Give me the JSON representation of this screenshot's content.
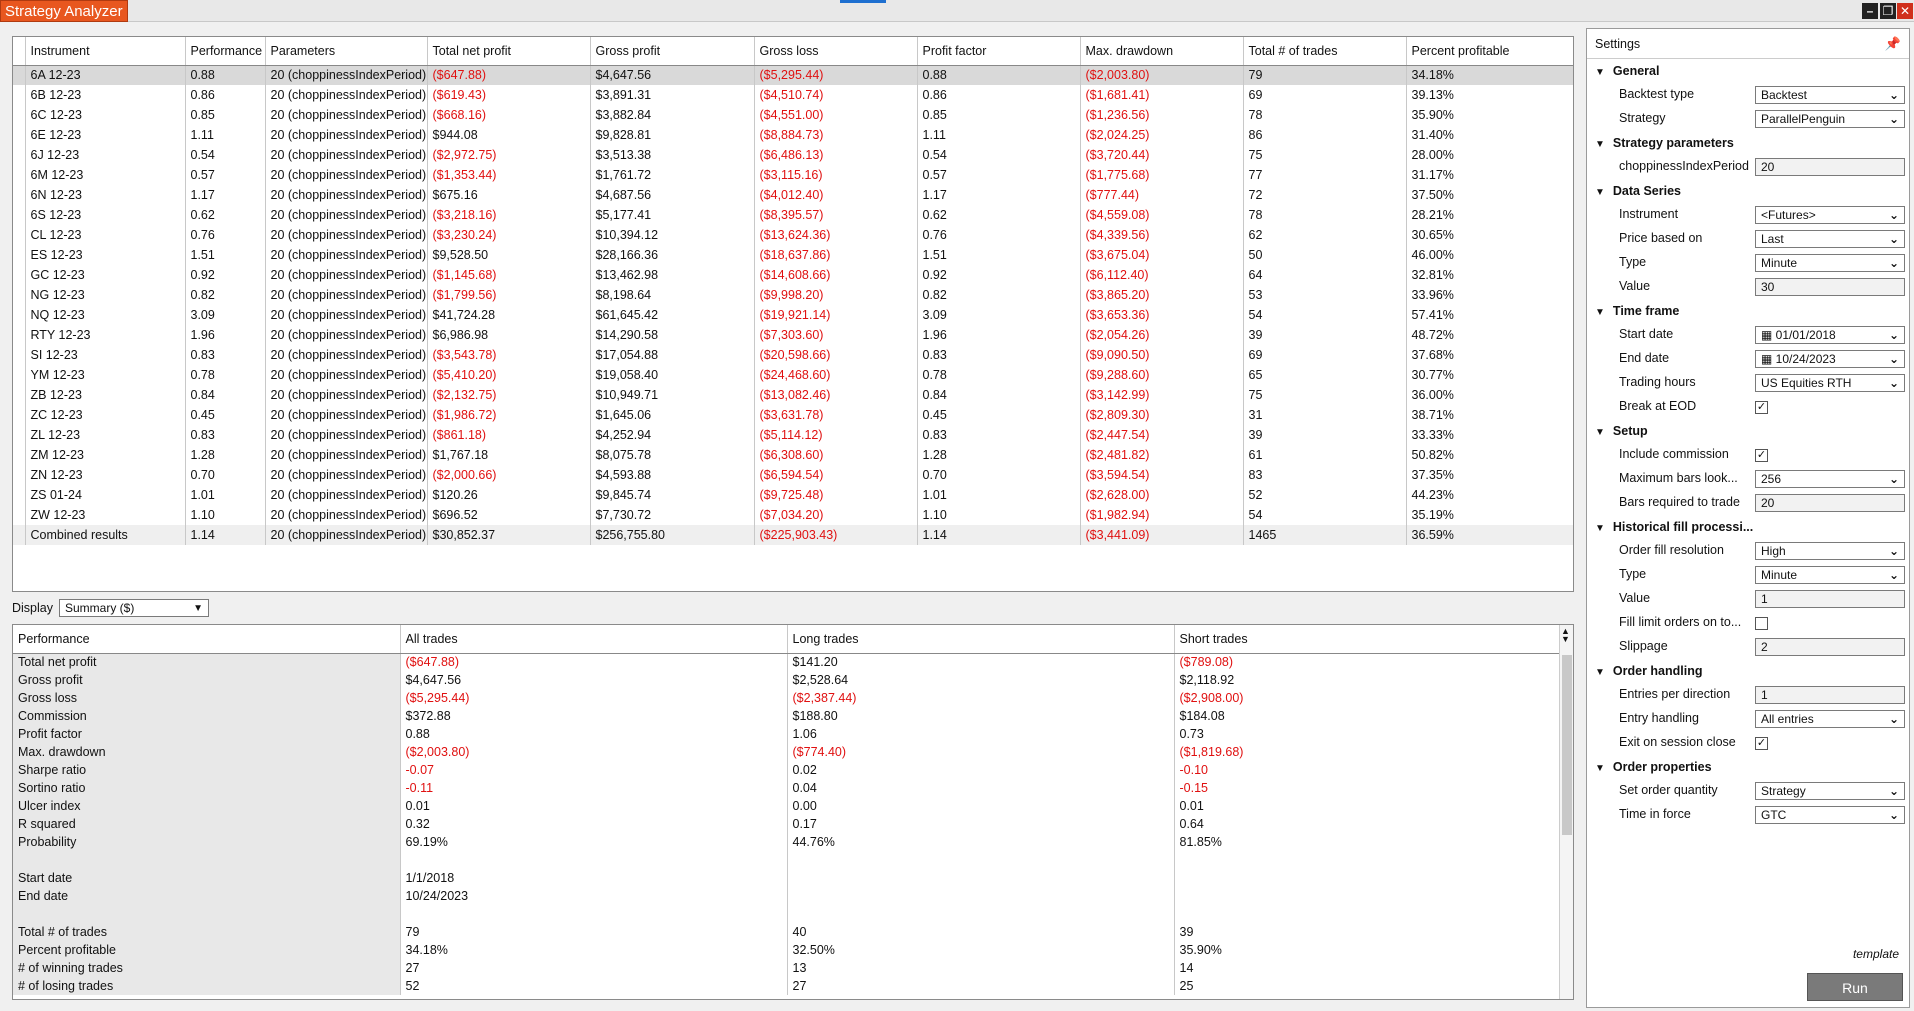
{
  "window": {
    "title": "Strategy Analyzer",
    "minimize_icon": "minimize-icon",
    "restore_icon": "restore-icon",
    "close_icon": "close-icon"
  },
  "results": {
    "columns": [
      "Instrument",
      "Performance",
      "Parameters",
      "Total net profit",
      "Gross profit",
      "Gross loss",
      "Profit factor",
      "Max. drawdown",
      "Total # of trades",
      "Percent profitable"
    ],
    "rows": [
      [
        "6A 12-23",
        "0.88",
        "20 (choppinessIndexPeriod)",
        "($647.88)",
        "$4,647.56",
        "($5,295.44)",
        "0.88",
        "($2,003.80)",
        "79",
        "34.18%"
      ],
      [
        "6B 12-23",
        "0.86",
        "20 (choppinessIndexPeriod)",
        "($619.43)",
        "$3,891.31",
        "($4,510.74)",
        "0.86",
        "($1,681.41)",
        "69",
        "39.13%"
      ],
      [
        "6C 12-23",
        "0.85",
        "20 (choppinessIndexPeriod)",
        "($668.16)",
        "$3,882.84",
        "($4,551.00)",
        "0.85",
        "($1,236.56)",
        "78",
        "35.90%"
      ],
      [
        "6E 12-23",
        "1.11",
        "20 (choppinessIndexPeriod)",
        "$944.08",
        "$9,828.81",
        "($8,884.73)",
        "1.11",
        "($2,024.25)",
        "86",
        "31.40%"
      ],
      [
        "6J 12-23",
        "0.54",
        "20 (choppinessIndexPeriod)",
        "($2,972.75)",
        "$3,513.38",
        "($6,486.13)",
        "0.54",
        "($3,720.44)",
        "75",
        "28.00%"
      ],
      [
        "6M 12-23",
        "0.57",
        "20 (choppinessIndexPeriod)",
        "($1,353.44)",
        "$1,761.72",
        "($3,115.16)",
        "0.57",
        "($1,775.68)",
        "77",
        "31.17%"
      ],
      [
        "6N 12-23",
        "1.17",
        "20 (choppinessIndexPeriod)",
        "$675.16",
        "$4,687.56",
        "($4,012.40)",
        "1.17",
        "($777.44)",
        "72",
        "37.50%"
      ],
      [
        "6S 12-23",
        "0.62",
        "20 (choppinessIndexPeriod)",
        "($3,218.16)",
        "$5,177.41",
        "($8,395.57)",
        "0.62",
        "($4,559.08)",
        "78",
        "28.21%"
      ],
      [
        "CL 12-23",
        "0.76",
        "20 (choppinessIndexPeriod)",
        "($3,230.24)",
        "$10,394.12",
        "($13,624.36)",
        "0.76",
        "($4,339.56)",
        "62",
        "30.65%"
      ],
      [
        "ES 12-23",
        "1.51",
        "20 (choppinessIndexPeriod)",
        "$9,528.50",
        "$28,166.36",
        "($18,637.86)",
        "1.51",
        "($3,675.04)",
        "50",
        "46.00%"
      ],
      [
        "GC 12-23",
        "0.92",
        "20 (choppinessIndexPeriod)",
        "($1,145.68)",
        "$13,462.98",
        "($14,608.66)",
        "0.92",
        "($6,112.40)",
        "64",
        "32.81%"
      ],
      [
        "NG 12-23",
        "0.82",
        "20 (choppinessIndexPeriod)",
        "($1,799.56)",
        "$8,198.64",
        "($9,998.20)",
        "0.82",
        "($3,865.20)",
        "53",
        "33.96%"
      ],
      [
        "NQ 12-23",
        "3.09",
        "20 (choppinessIndexPeriod)",
        "$41,724.28",
        "$61,645.42",
        "($19,921.14)",
        "3.09",
        "($3,653.36)",
        "54",
        "57.41%"
      ],
      [
        "RTY 12-23",
        "1.96",
        "20 (choppinessIndexPeriod)",
        "$6,986.98",
        "$14,290.58",
        "($7,303.60)",
        "1.96",
        "($2,054.26)",
        "39",
        "48.72%"
      ],
      [
        "SI 12-23",
        "0.83",
        "20 (choppinessIndexPeriod)",
        "($3,543.78)",
        "$17,054.88",
        "($20,598.66)",
        "0.83",
        "($9,090.50)",
        "69",
        "37.68%"
      ],
      [
        "YM 12-23",
        "0.78",
        "20 (choppinessIndexPeriod)",
        "($5,410.20)",
        "$19,058.40",
        "($24,468.60)",
        "0.78",
        "($9,288.60)",
        "65",
        "30.77%"
      ],
      [
        "ZB 12-23",
        "0.84",
        "20 (choppinessIndexPeriod)",
        "($2,132.75)",
        "$10,949.71",
        "($13,082.46)",
        "0.84",
        "($3,142.99)",
        "75",
        "36.00%"
      ],
      [
        "ZC 12-23",
        "0.45",
        "20 (choppinessIndexPeriod)",
        "($1,986.72)",
        "$1,645.06",
        "($3,631.78)",
        "0.45",
        "($2,809.30)",
        "31",
        "38.71%"
      ],
      [
        "ZL 12-23",
        "0.83",
        "20 (choppinessIndexPeriod)",
        "($861.18)",
        "$4,252.94",
        "($5,114.12)",
        "0.83",
        "($2,447.54)",
        "39",
        "33.33%"
      ],
      [
        "ZM 12-23",
        "1.28",
        "20 (choppinessIndexPeriod)",
        "$1,767.18",
        "$8,075.78",
        "($6,308.60)",
        "1.28",
        "($2,481.82)",
        "61",
        "50.82%"
      ],
      [
        "ZN 12-23",
        "0.70",
        "20 (choppinessIndexPeriod)",
        "($2,000.66)",
        "$4,593.88",
        "($6,594.54)",
        "0.70",
        "($3,594.54)",
        "83",
        "37.35%"
      ],
      [
        "ZS 01-24",
        "1.01",
        "20 (choppinessIndexPeriod)",
        "$120.26",
        "$9,845.74",
        "($9,725.48)",
        "1.01",
        "($2,628.00)",
        "52",
        "44.23%"
      ],
      [
        "ZW 12-23",
        "1.10",
        "20 (choppinessIndexPeriod)",
        "$696.52",
        "$7,730.72",
        "($7,034.20)",
        "1.10",
        "($1,982.94)",
        "54",
        "35.19%"
      ],
      [
        "Combined results",
        "1.14",
        "20 (choppinessIndexPeriod)",
        "$30,852.37",
        "$256,755.80",
        "($225,903.43)",
        "1.14",
        "($3,441.09)",
        "1465",
        "36.59%"
      ]
    ]
  },
  "display": {
    "label": "Display",
    "value": "Summary ($)"
  },
  "summary": {
    "columns": [
      "Performance",
      "All trades",
      "Long trades",
      "Short trades"
    ],
    "rows": [
      [
        "Total net profit",
        "($647.88)",
        "$141.20",
        "($789.08)"
      ],
      [
        "Gross profit",
        "$4,647.56",
        "$2,528.64",
        "$2,118.92"
      ],
      [
        "Gross loss",
        "($5,295.44)",
        "($2,387.44)",
        "($2,908.00)"
      ],
      [
        "Commission",
        "$372.88",
        "$188.80",
        "$184.08"
      ],
      [
        "Profit factor",
        "0.88",
        "1.06",
        "0.73"
      ],
      [
        "Max. drawdown",
        "($2,003.80)",
        "($774.40)",
        "($1,819.68)"
      ],
      [
        "Sharpe ratio",
        "-0.07",
        "0.02",
        "-0.10"
      ],
      [
        "Sortino ratio",
        "-0.11",
        "0.04",
        "-0.15"
      ],
      [
        "Ulcer index",
        "0.01",
        "0.00",
        "0.01"
      ],
      [
        "R squared",
        "0.32",
        "0.17",
        "0.64"
      ],
      [
        "Probability",
        "69.19%",
        "44.76%",
        "81.85%"
      ],
      [
        "",
        "",
        "",
        ""
      ],
      [
        "Start date",
        "1/1/2018",
        "",
        ""
      ],
      [
        "End date",
        "10/24/2023",
        "",
        ""
      ],
      [
        "",
        "",
        "",
        ""
      ],
      [
        "Total # of trades",
        "79",
        "40",
        "39"
      ],
      [
        "Percent profitable",
        "34.18%",
        "32.50%",
        "35.90%"
      ],
      [
        "# of winning trades",
        "27",
        "13",
        "14"
      ],
      [
        "# of losing trades",
        "52",
        "27",
        "25"
      ]
    ]
  },
  "settings": {
    "title": "Settings",
    "groups": [
      {
        "name": "General",
        "props": [
          {
            "label": "Backtest type",
            "value": "Backtest",
            "kind": "dropdown"
          },
          {
            "label": "Strategy",
            "value": "ParallelPenguin",
            "kind": "dropdown"
          }
        ]
      },
      {
        "name": "Strategy parameters",
        "props": [
          {
            "label": "choppinessIndexPeriod",
            "value": "20",
            "kind": "text"
          }
        ]
      },
      {
        "name": "Data Series",
        "props": [
          {
            "label": "Instrument",
            "value": "<Futures>",
            "kind": "dropdown"
          },
          {
            "label": "Price based on",
            "value": "Last",
            "kind": "dropdown"
          },
          {
            "label": "Type",
            "value": "Minute",
            "kind": "dropdown"
          },
          {
            "label": "Value",
            "value": "30",
            "kind": "text"
          }
        ]
      },
      {
        "name": "Time frame",
        "props": [
          {
            "label": "Start date",
            "value": "01/01/2018",
            "kind": "date"
          },
          {
            "label": "End date",
            "value": "10/24/2023",
            "kind": "date"
          },
          {
            "label": "Trading hours",
            "value": "US Equities RTH",
            "kind": "dropdown"
          },
          {
            "label": "Break at EOD",
            "value": "true",
            "kind": "check"
          }
        ]
      },
      {
        "name": "Setup",
        "props": [
          {
            "label": "Include commission",
            "value": "true",
            "kind": "check"
          },
          {
            "label": "Maximum bars look...",
            "value": "256",
            "kind": "dropdown"
          },
          {
            "label": "Bars required to trade",
            "value": "20",
            "kind": "text"
          }
        ]
      },
      {
        "name": "Historical fill processi...",
        "props": [
          {
            "label": "Order fill resolution",
            "value": "High",
            "kind": "dropdown"
          },
          {
            "label": "Type",
            "value": "Minute",
            "kind": "dropdown"
          },
          {
            "label": "Value",
            "value": "1",
            "kind": "text"
          },
          {
            "label": "Fill limit orders on to...",
            "value": "false",
            "kind": "check"
          },
          {
            "label": "Slippage",
            "value": "2",
            "kind": "text"
          }
        ]
      },
      {
        "name": "Order handling",
        "props": [
          {
            "label": "Entries per direction",
            "value": "1",
            "kind": "text"
          },
          {
            "label": "Entry handling",
            "value": "All entries",
            "kind": "dropdown"
          },
          {
            "label": "Exit on session close",
            "value": "true",
            "kind": "check"
          }
        ]
      },
      {
        "name": "Order properties",
        "props": [
          {
            "label": "Set order quantity",
            "value": "Strategy",
            "kind": "dropdown"
          },
          {
            "label": "Time in force",
            "value": "GTC",
            "kind": "dropdown"
          }
        ]
      }
    ],
    "template_label": "template",
    "run_label": "Run"
  }
}
